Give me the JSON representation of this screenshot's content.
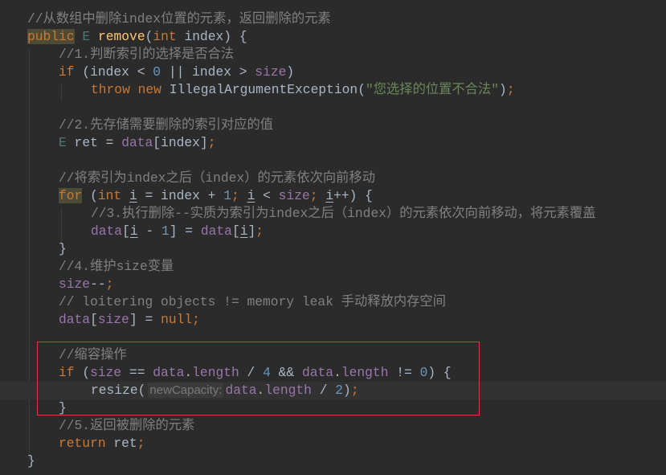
{
  "editor": {
    "current_line_index": 21,
    "highlight_box_color": "#e0393b",
    "lines": [
      {
        "indent": 0,
        "tokens": [
          {
            "t": "//从数组中删除index位置的元素，返回删除的元素",
            "c": "comment"
          }
        ]
      },
      {
        "indent": 0,
        "tokens": [
          {
            "t": "public",
            "c": "kw hl-kw"
          },
          {
            "t": " ",
            "c": "plain"
          },
          {
            "t": "E",
            "c": "type"
          },
          {
            "t": " ",
            "c": "plain"
          },
          {
            "t": "remove",
            "c": "fn"
          },
          {
            "t": "(",
            "c": "plain"
          },
          {
            "t": "int",
            "c": "kw"
          },
          {
            "t": " index) {",
            "c": "plain"
          }
        ]
      },
      {
        "indent": 1,
        "tokens": [
          {
            "t": "//1.判断索引的选择是否合法",
            "c": "comment"
          }
        ]
      },
      {
        "indent": 1,
        "tokens": [
          {
            "t": "if",
            "c": "kw"
          },
          {
            "t": " (index < ",
            "c": "plain"
          },
          {
            "t": "0",
            "c": "num"
          },
          {
            "t": " || index > ",
            "c": "plain"
          },
          {
            "t": "size",
            "c": "field"
          },
          {
            "t": ")",
            "c": "plain"
          }
        ]
      },
      {
        "indent": 2,
        "tokens": [
          {
            "t": "throw new",
            "c": "kw"
          },
          {
            "t": " IllegalArgumentException(",
            "c": "plain"
          },
          {
            "t": "\"您选择的位置不合法\"",
            "c": "str"
          },
          {
            "t": ")",
            "c": "plain"
          },
          {
            "t": ";",
            "c": "semi"
          }
        ]
      },
      {
        "indent": 1,
        "tokens": []
      },
      {
        "indent": 1,
        "tokens": [
          {
            "t": "//2.先存储需要删除的索引对应的值",
            "c": "comment"
          }
        ]
      },
      {
        "indent": 1,
        "tokens": [
          {
            "t": "E",
            "c": "type"
          },
          {
            "t": " ret = ",
            "c": "plain"
          },
          {
            "t": "data",
            "c": "field"
          },
          {
            "t": "[index]",
            "c": "plain"
          },
          {
            "t": ";",
            "c": "semi"
          }
        ]
      },
      {
        "indent": 1,
        "tokens": []
      },
      {
        "indent": 1,
        "tokens": [
          {
            "t": "//将索引为index之后（index）的元素依次向前移动",
            "c": "comment"
          }
        ]
      },
      {
        "indent": 1,
        "tokens": [
          {
            "t": "for",
            "c": "kw hl-kw"
          },
          {
            "t": " (",
            "c": "plain"
          },
          {
            "t": "int",
            "c": "kw"
          },
          {
            "t": " ",
            "c": "plain"
          },
          {
            "t": "i",
            "c": "var"
          },
          {
            "t": " = index + ",
            "c": "plain"
          },
          {
            "t": "1",
            "c": "num"
          },
          {
            "t": ";",
            "c": "semi"
          },
          {
            "t": " ",
            "c": "plain"
          },
          {
            "t": "i",
            "c": "var"
          },
          {
            "t": " < ",
            "c": "plain"
          },
          {
            "t": "size",
            "c": "field"
          },
          {
            "t": ";",
            "c": "semi"
          },
          {
            "t": " ",
            "c": "plain"
          },
          {
            "t": "i",
            "c": "var"
          },
          {
            "t": "++) {",
            "c": "plain"
          }
        ]
      },
      {
        "indent": 2,
        "tokens": [
          {
            "t": "//3.执行删除--实质为索引为index之后（index）的元素依次向前移动，将元素覆盖",
            "c": "comment"
          }
        ]
      },
      {
        "indent": 2,
        "tokens": [
          {
            "t": "data",
            "c": "field"
          },
          {
            "t": "[",
            "c": "plain"
          },
          {
            "t": "i",
            "c": "var"
          },
          {
            "t": " - ",
            "c": "plain"
          },
          {
            "t": "1",
            "c": "num"
          },
          {
            "t": "] = ",
            "c": "plain"
          },
          {
            "t": "data",
            "c": "field"
          },
          {
            "t": "[",
            "c": "plain"
          },
          {
            "t": "i",
            "c": "var"
          },
          {
            "t": "]",
            "c": "plain"
          },
          {
            "t": ";",
            "c": "semi"
          }
        ]
      },
      {
        "indent": 1,
        "tokens": [
          {
            "t": "}",
            "c": "plain"
          }
        ]
      },
      {
        "indent": 1,
        "tokens": [
          {
            "t": "//4.维护size变量",
            "c": "comment"
          }
        ]
      },
      {
        "indent": 1,
        "tokens": [
          {
            "t": "size",
            "c": "field"
          },
          {
            "t": "--",
            "c": "plain"
          },
          {
            "t": ";",
            "c": "semi"
          }
        ]
      },
      {
        "indent": 1,
        "tokens": [
          {
            "t": "// loitering objects != memory leak 手动释放内存空间",
            "c": "comment"
          }
        ]
      },
      {
        "indent": 1,
        "tokens": [
          {
            "t": "data",
            "c": "field"
          },
          {
            "t": "[",
            "c": "plain"
          },
          {
            "t": "size",
            "c": "field"
          },
          {
            "t": "] = ",
            "c": "plain"
          },
          {
            "t": "null",
            "c": "kw"
          },
          {
            "t": ";",
            "c": "semi"
          }
        ]
      },
      {
        "indent": 1,
        "tokens": []
      },
      {
        "indent": 1,
        "tokens": [
          {
            "t": "//缩容操作",
            "c": "comment"
          }
        ]
      },
      {
        "indent": 1,
        "tokens": [
          {
            "t": "if",
            "c": "kw"
          },
          {
            "t": " (",
            "c": "plain"
          },
          {
            "t": "size",
            "c": "field"
          },
          {
            "t": " == ",
            "c": "plain"
          },
          {
            "t": "data",
            "c": "field"
          },
          {
            "t": ".",
            "c": "plain"
          },
          {
            "t": "length",
            "c": "field"
          },
          {
            "t": " / ",
            "c": "plain"
          },
          {
            "t": "4",
            "c": "num"
          },
          {
            "t": " && ",
            "c": "plain"
          },
          {
            "t": "data",
            "c": "field"
          },
          {
            "t": ".",
            "c": "plain"
          },
          {
            "t": "length",
            "c": "field"
          },
          {
            "t": " != ",
            "c": "plain"
          },
          {
            "t": "0",
            "c": "num"
          },
          {
            "t": ") {",
            "c": "plain"
          }
        ]
      },
      {
        "indent": 2,
        "tokens": [
          {
            "t": "resize(",
            "c": "plain"
          },
          {
            "t": "newCapacity:",
            "c": "hint"
          },
          {
            "t": "data",
            "c": "field"
          },
          {
            "t": ".",
            "c": "plain"
          },
          {
            "t": "length",
            "c": "field"
          },
          {
            "t": " / ",
            "c": "plain"
          },
          {
            "t": "2",
            "c": "num"
          },
          {
            "t": ")",
            "c": "plain"
          },
          {
            "t": ";",
            "c": "semi"
          }
        ]
      },
      {
        "indent": 1,
        "tokens": [
          {
            "t": "}",
            "c": "plain"
          }
        ]
      },
      {
        "indent": 1,
        "tokens": [
          {
            "t": "//5.返回被删除的元素",
            "c": "comment"
          }
        ]
      },
      {
        "indent": 1,
        "tokens": [
          {
            "t": "return",
            "c": "kw"
          },
          {
            "t": " ret",
            "c": "plain"
          },
          {
            "t": ";",
            "c": "semi"
          }
        ]
      },
      {
        "indent": 0,
        "tokens": [
          {
            "t": "}",
            "c": "plain"
          }
        ]
      }
    ]
  }
}
